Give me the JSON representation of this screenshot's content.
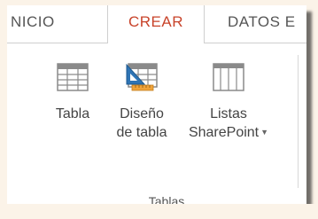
{
  "tabs": {
    "inicio": "NICIO",
    "crear": "CREAR",
    "datos": "DATOS E"
  },
  "commands": {
    "tabla": {
      "label": "Tabla",
      "icon": "table-icon"
    },
    "diseno": {
      "line1": "Diseño",
      "line2": "de tabla",
      "icon": "table-design-icon"
    },
    "listas": {
      "line1": "Listas",
      "line2": "SharePoint",
      "icon": "sharepoint-list-icon"
    }
  },
  "group": {
    "label": "Tablas"
  },
  "colors": {
    "active_tab": "#c8432a",
    "text": "#444444",
    "backdrop": "#fbf3e8",
    "icon_blue": "#2e74b5",
    "icon_orange": "#f0a33a"
  }
}
